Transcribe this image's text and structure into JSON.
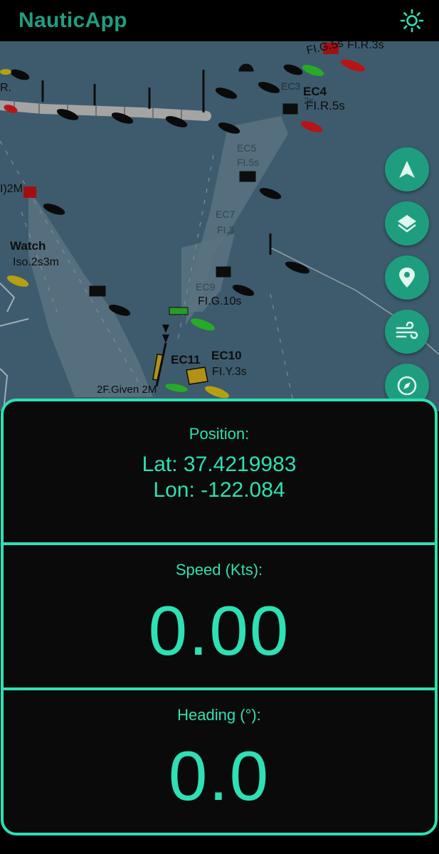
{
  "colors": {
    "accent": "#2EE0B3",
    "title": "#1F9E82",
    "fab": "#1E9E7F",
    "panel_bg": "#0A0A0A",
    "map_water": "#4B7086",
    "map_channel": "#6D8C9E"
  },
  "app": {
    "title": "NauticApp",
    "theme_icon": "sun-icon"
  },
  "map": {
    "labels": [
      {
        "id": "fl-top",
        "text": "FI.G.5s"
      },
      {
        "id": "fl-r",
        "text": "FI.R.3s"
      },
      {
        "id": "ec4",
        "text": "EC4"
      },
      {
        "id": "ec4-light",
        "text": "FI.R.5s"
      },
      {
        "id": "ec3",
        "text": "EC3"
      },
      {
        "id": "ec2",
        "text": "2s"
      },
      {
        "id": "ec-mid1",
        "text": "EC5"
      },
      {
        "id": "ec-mid2",
        "text": "FI.5s"
      },
      {
        "id": "ec7",
        "text": "EC7"
      },
      {
        "id": "ec7-light",
        "text": "FI.3"
      },
      {
        "id": "ec8",
        "text": "EC9"
      },
      {
        "id": "watch",
        "text": "Watch"
      },
      {
        "id": "iso",
        "text": "Iso.2s3m"
      },
      {
        "id": "left-2m",
        "text": "I)2M"
      },
      {
        "id": "left-r",
        "text": "R."
      },
      {
        "id": "flg10",
        "text": "FI.G.10s"
      },
      {
        "id": "ec11",
        "text": "EC11"
      },
      {
        "id": "ec10",
        "text": "EC10"
      },
      {
        "id": "fly",
        "text": "FI.Y.3s"
      },
      {
        "id": "given",
        "text": "2F.Given 2M"
      }
    ],
    "fabs": [
      {
        "name": "navigation-button",
        "icon": "navigation-arrow-icon"
      },
      {
        "name": "layers-button",
        "icon": "layers-icon"
      },
      {
        "name": "location-button",
        "icon": "location-pin-icon"
      },
      {
        "name": "wind-button",
        "icon": "wind-icon"
      },
      {
        "name": "compass-button",
        "icon": "compass-icon"
      },
      {
        "name": "book-button",
        "icon": "book-icon"
      }
    ]
  },
  "position": {
    "label": "Position:",
    "lat": "Lat: 37.4219983",
    "lon": "Lon: -122.084"
  },
  "speed": {
    "label": "Speed (Kts):",
    "value": "0.00"
  },
  "heading": {
    "label": "Heading (°):",
    "value": "0.0"
  }
}
